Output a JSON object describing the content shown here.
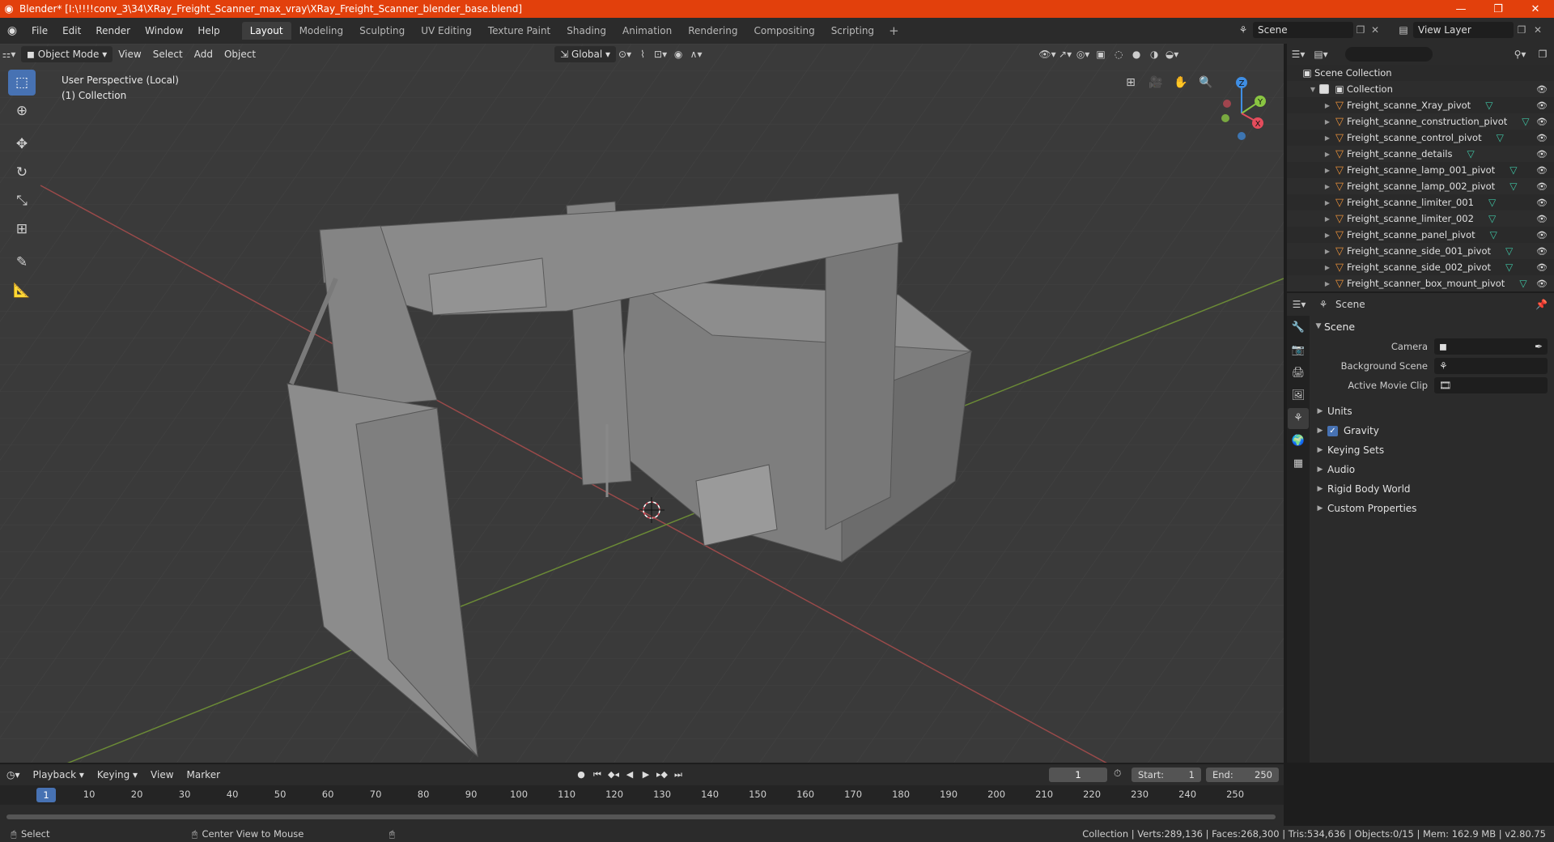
{
  "window": {
    "title": "Blender* [I:\\!!!!conv_3\\34\\XRay_Freight_Scanner_max_vray\\XRay_Freight_Scanner_blender_base.blend]",
    "minimize": "—",
    "restore": "❐",
    "close": "✕"
  },
  "topbar": {
    "menus": [
      "File",
      "Edit",
      "Render",
      "Window",
      "Help"
    ],
    "workspaces": [
      "Layout",
      "Modeling",
      "Sculpting",
      "UV Editing",
      "Texture Paint",
      "Shading",
      "Animation",
      "Rendering",
      "Compositing",
      "Scripting"
    ],
    "active_workspace": "Layout",
    "scene": "Scene",
    "view_layer": "View Layer"
  },
  "viewport": {
    "mode": "Object Mode",
    "menus": [
      "View",
      "Select",
      "Add",
      "Object"
    ],
    "transform": "Global",
    "info_line1": "User Perspective (Local)",
    "info_line2": "(1) Collection",
    "gizmo_axes": [
      "Z",
      "Y",
      "X"
    ],
    "colors": {
      "x_axis": "#e44c5c",
      "y_axis": "#8ac642",
      "z_axis": "#3f8ee4",
      "select": "#4772b3"
    }
  },
  "outliner": {
    "search_placeholder": "",
    "root": "Scene Collection",
    "collection": "Collection",
    "items": [
      "Freight_scanne_Xray_pivot",
      "Freight_scanne_construction_pivot",
      "Freight_scanne_control_pivot",
      "Freight_scanne_details",
      "Freight_scanne_lamp_001_pivot",
      "Freight_scanne_lamp_002_pivot",
      "Freight_scanne_limiter_001",
      "Freight_scanne_limiter_002",
      "Freight_scanne_panel_pivot",
      "Freight_scanne_side_001_pivot",
      "Freight_scanne_side_002_pivot",
      "Freight_scanner_box_mount_pivot"
    ]
  },
  "properties": {
    "context": "Scene",
    "panel_title": "Scene",
    "camera_label": "Camera",
    "background_scene_label": "Background Scene",
    "active_clip_label": "Active Movie Clip",
    "subpanels": [
      "Units",
      "Gravity",
      "Keying Sets",
      "Audio",
      "Rigid Body World",
      "Custom Properties"
    ]
  },
  "timeline": {
    "menus": [
      "Playback",
      "Keying",
      "View",
      "Marker"
    ],
    "current_frame": "1",
    "start_label": "Start:",
    "start": "1",
    "end_label": "End:",
    "end": "250",
    "ticks": [
      "10",
      "20",
      "30",
      "40",
      "50",
      "60",
      "70",
      "80",
      "90",
      "100",
      "110",
      "120",
      "130",
      "140",
      "150",
      "160",
      "170",
      "180",
      "190",
      "200",
      "210",
      "220",
      "230",
      "240",
      "250"
    ]
  },
  "statusbar": {
    "select": "Select",
    "center_view": "Center View to Mouse",
    "stats": "Collection | Verts:289,136 | Faces:268,300 | Tris:534,636 | Objects:0/15 | Mem: 162.9 MB | v2.80.75"
  }
}
